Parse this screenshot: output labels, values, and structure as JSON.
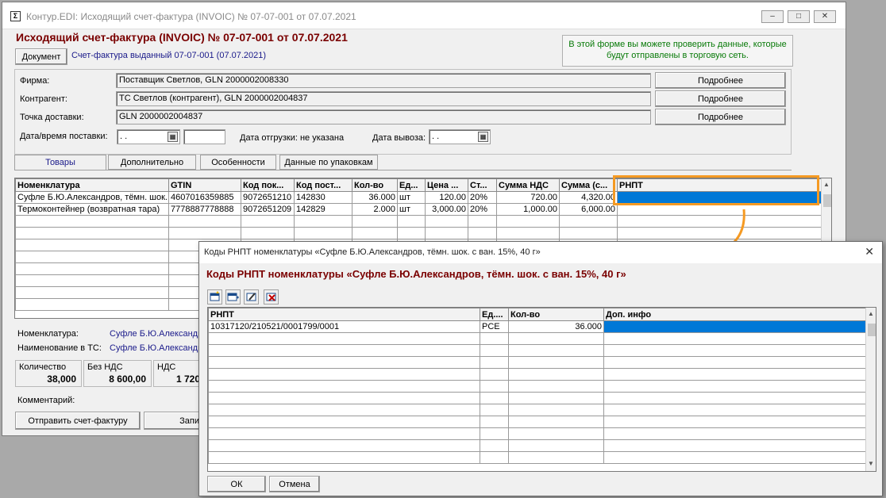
{
  "window": {
    "title": "Контур.EDI: Исходящий счет-фактура (INVOIC) № 07-07-001 от 07.07.2021",
    "minimize": "–",
    "maximize": "□",
    "close": "✕"
  },
  "header": {
    "title": "Исходящий счет-фактура (INVOIC) № 07-07-001 от 07.07.2021",
    "doc_button": "Документ",
    "doc_subtitle": "Счет-фактура выданный 07-07-001 (07.07.2021)",
    "info_text": "В этой форме вы можете проверить данные, которые будут отправлены в торговую сеть."
  },
  "form": {
    "firm_label": "Фирма:",
    "firm_value": "Поставщик Светлов, GLN 2000002008330",
    "contractor_label": "Контрагент:",
    "contractor_value": "ТС Светлов (контрагент), GLN 2000002004837",
    "delivery_label": "Точка доставки:",
    "delivery_value": "GLN 2000002004837",
    "details_button": "Подробнее",
    "delivery_dt_label": "Дата/время поставки:",
    "delivery_date_value": " .  .",
    "shipment_text": "Дата отгрузки: не указана",
    "export_label": "Дата вывоза:",
    "export_value": " .  ."
  },
  "tabs": [
    "Товары",
    "Дополнительно",
    "Особенности",
    "Данные по упаковкам"
  ],
  "goods_table": {
    "columns": [
      "Номенклатура",
      "GTIN",
      "Код пок...",
      "Код пост...",
      "Кол-во",
      "Ед...",
      "Цена ...",
      "Ст...",
      "Сумма НДС",
      "Сумма (с...",
      "РНПТ"
    ],
    "rows": [
      [
        "Суфле Б.Ю.Александров, тёмн. шок.",
        "4607016359885",
        "9072651210",
        "142830",
        "36.000",
        "шт",
        "120.00",
        "20%",
        "720.00",
        "4,320.00",
        ""
      ],
      [
        "Термоконтейнер (возвратная тара)",
        "7778887778888",
        "9072651209",
        "142829",
        "2.000",
        "шт",
        "3,000.00",
        "20%",
        "1,000.00",
        "6,000.00",
        ""
      ]
    ]
  },
  "bottom": {
    "nomenclature_label": "Номенклатура:",
    "nomenclature_value": "Суфле Б.Ю.Александр",
    "ts_name_label": "Наименование в ТС:",
    "ts_name_value": "Суфле Б.Ю.Александр",
    "qty_label": "Количество",
    "qty_value": "38,000",
    "no_vat_label": "Без НДС",
    "no_vat_value": "8 600,00",
    "vat_label": "НДС",
    "vat_value": "1 720",
    "comment_label": "Комментарий:",
    "send_button": "Отправить счет-фактуру",
    "save_button_partial": "Запи"
  },
  "dialog": {
    "title": "Коды РНПТ номенклатуры «Суфле Б.Ю.Александров, тёмн. шок. с ван. 15%, 40 г»",
    "heading": "Коды РНПТ номенклатуры «Суфле Б.Ю.Александров, тёмн. шок. с ван. 15%, 40 г»",
    "close": "✕",
    "columns": [
      "РНПТ",
      "Ед....",
      "Кол-во",
      "Доп. инфо"
    ],
    "rows": [
      [
        "10317120/210521/0001799/0001",
        "PCE",
        "36.000",
        ""
      ]
    ],
    "ok_button": "ОК",
    "cancel_button": "Отмена"
  },
  "colors": {
    "title_red": "#7a0000",
    "link_blue": "#1a1a8a",
    "info_green": "#087a08",
    "highlight_orange": "#f59a23",
    "selection_blue": "#0078d7"
  }
}
